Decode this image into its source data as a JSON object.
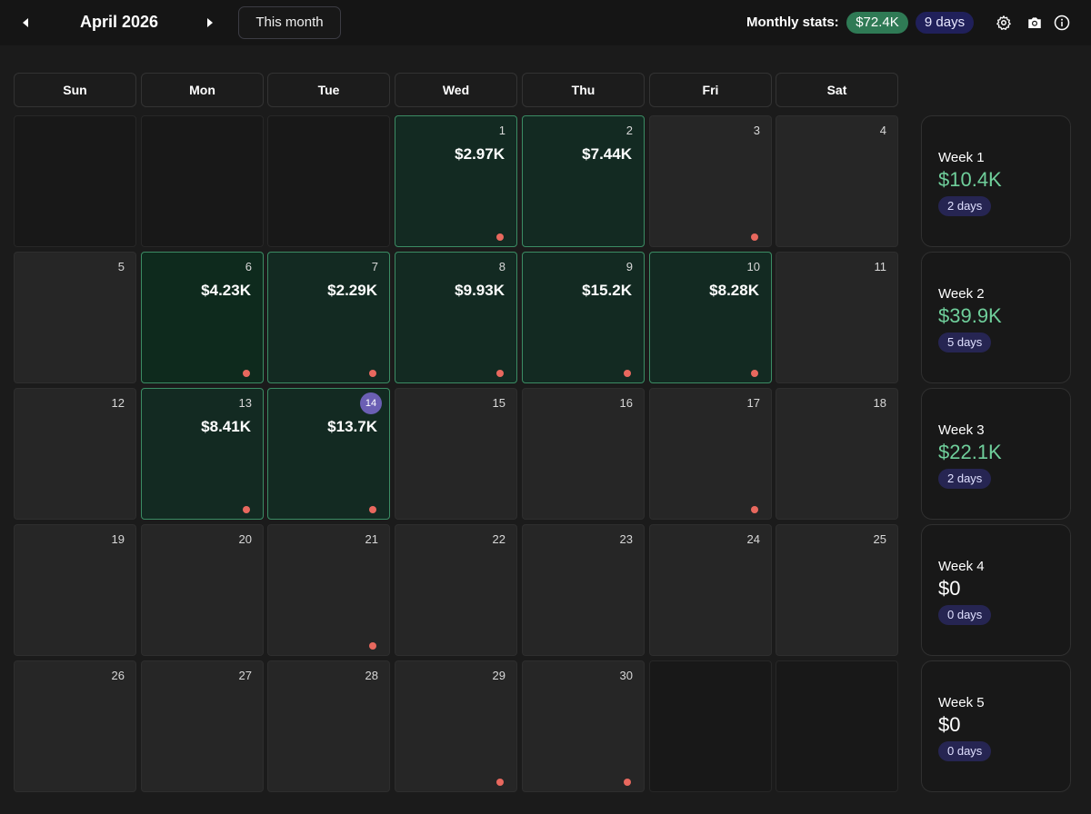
{
  "header": {
    "month_title": "April 2026",
    "this_month_label": "This month",
    "stats_label": "Monthly stats:",
    "stats_profit": "$72.4K",
    "stats_days": "9 days"
  },
  "weekdays": [
    "Sun",
    "Mon",
    "Tue",
    "Wed",
    "Thu",
    "Fri",
    "Sat"
  ],
  "days": {
    "d1": {
      "num": "1",
      "amount": "$2.97K"
    },
    "d2": {
      "num": "2",
      "amount": "$7.44K"
    },
    "d3": {
      "num": "3"
    },
    "d4": {
      "num": "4"
    },
    "d5": {
      "num": "5"
    },
    "d6": {
      "num": "6",
      "amount": "$4.23K"
    },
    "d7": {
      "num": "7",
      "amount": "$2.29K"
    },
    "d8": {
      "num": "8",
      "amount": "$9.93K"
    },
    "d9": {
      "num": "9",
      "amount": "$15.2K"
    },
    "d10": {
      "num": "10",
      "amount": "$8.28K"
    },
    "d11": {
      "num": "11"
    },
    "d12": {
      "num": "12"
    },
    "d13": {
      "num": "13",
      "amount": "$8.41K"
    },
    "d14": {
      "num": "14",
      "amount": "$13.7K"
    },
    "d15": {
      "num": "15"
    },
    "d16": {
      "num": "16"
    },
    "d17": {
      "num": "17"
    },
    "d18": {
      "num": "18"
    },
    "d19": {
      "num": "19"
    },
    "d20": {
      "num": "20"
    },
    "d21": {
      "num": "21"
    },
    "d22": {
      "num": "22"
    },
    "d23": {
      "num": "23"
    },
    "d24": {
      "num": "24"
    },
    "d25": {
      "num": "25"
    },
    "d26": {
      "num": "26"
    },
    "d27": {
      "num": "27"
    },
    "d28": {
      "num": "28"
    },
    "d29": {
      "num": "29"
    },
    "d30": {
      "num": "30"
    }
  },
  "weeks": [
    {
      "label": "Week 1",
      "amount": "$10.4K",
      "days": "2 days"
    },
    {
      "label": "Week 2",
      "amount": "$39.9K",
      "days": "5 days"
    },
    {
      "label": "Week 3",
      "amount": "$22.1K",
      "days": "2 days"
    },
    {
      "label": "Week 4",
      "amount": "$0",
      "days": "0 days"
    },
    {
      "label": "Week 5",
      "amount": "$0",
      "days": "0 days"
    }
  ],
  "icons": {
    "prev": "chevron-left-icon",
    "next": "chevron-right-icon",
    "settings": "gear-icon",
    "camera": "camera-icon",
    "info": "info-icon",
    "note_marker": "dot-icon"
  },
  "colors": {
    "profit_text": "#6fcf9b",
    "profit_cell": "#132a22",
    "profit_border": "#3b8c64",
    "today_badge": "#6b5fb4",
    "note_dot": "#e8685e",
    "days_pill": "#262552"
  }
}
